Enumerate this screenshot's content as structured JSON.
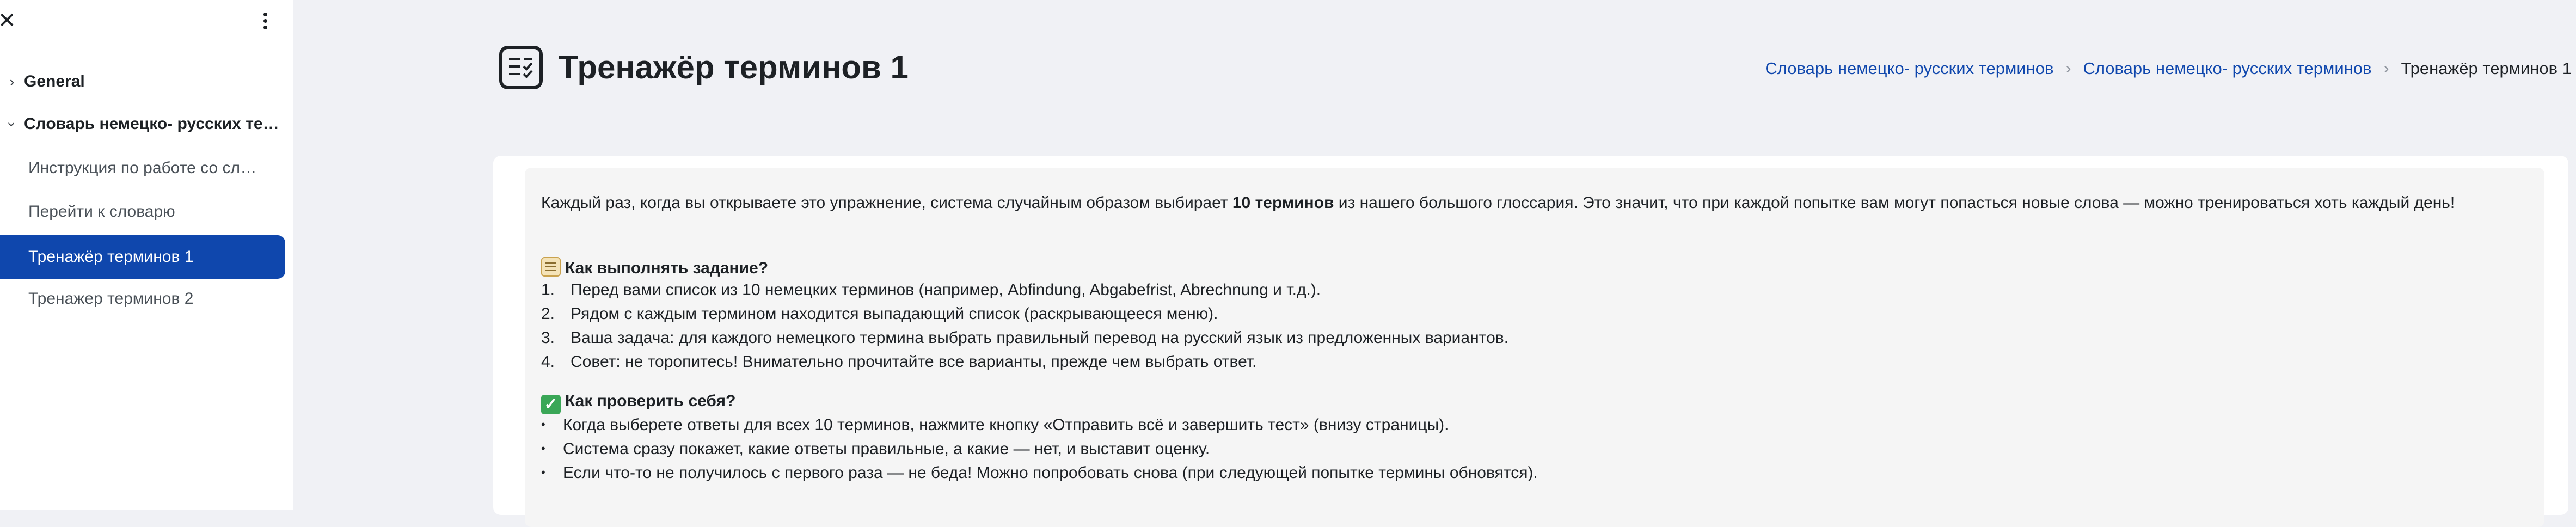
{
  "sidebar": {
    "close_icon": "✕",
    "sections": [
      {
        "label": "General"
      },
      {
        "label": "Словарь немецко- русских терминов"
      }
    ],
    "items": [
      {
        "label": "Инструкция по работе со словарем"
      },
      {
        "label": "Перейти к словарю"
      },
      {
        "label": "Тренажёр терминов 1"
      },
      {
        "label": "Тренажер терминов 2"
      }
    ]
  },
  "header": {
    "title": "Тренажёр терминов 1",
    "breadcrumb": [
      {
        "label": "Словарь немецко- русских терминов"
      },
      {
        "label": "Словарь немецко- русских терминов"
      },
      {
        "label": "Тренажёр терминов 1"
      }
    ]
  },
  "description": {
    "intro_before": "Каждый раз, когда вы открываете это упражнение, система случайным образом выбирает ",
    "intro_bold": "10 терминов",
    "intro_after": " из нашего большого глоссария. Это значит, что при каждой попытке вам могут попасться новые слова — можно тренироваться хоть каждый день!",
    "how_heading": "Как выполнять задание?",
    "how_items": [
      {
        "num": "1.",
        "text": "Перед вами список из 10 немецких терминов (например, Abfindung, Abgabefrist, Abrechnung и т.д.)."
      },
      {
        "num": "2.",
        "text": "Рядом с каждым термином находится выпадающий список (раскрывающееся меню)."
      },
      {
        "num": "3.",
        "text": "Ваша задача: для каждого немецкого термина выбрать правильный перевод на русский язык из предложенных вариантов."
      },
      {
        "num": "4.",
        "text": "Совет: не торопитесь! Внимательно прочитайте все варианты, прежде чем выбрать ответ."
      }
    ],
    "check_heading": "Как проверить себя?",
    "check_items": [
      {
        "bullet": "•",
        "text": "Когда выберете ответы для всех 10 терминов, нажмите кнопку «Отправить всё и завершить тест» (внизу страницы)."
      },
      {
        "bullet": "•",
        "text": "Система сразу покажет, какие ответы правильные, а какие — нет, и выставит оценку."
      },
      {
        "bullet": "•",
        "text": "Если что-то не получилось с первого раза — не беда! Можно попробовать снова (при следующей попытке термины обновятся)."
      }
    ]
  },
  "colors": {
    "accent": "#0f47ad",
    "page_bg": "#f0f1f5",
    "active_item_text": "#ffffff"
  },
  "icons": {
    "close": "close-icon",
    "more": "kebab-menu-icon",
    "section_expand": "chevron-icon",
    "activity": "quiz-checklist-icon",
    "breadcrumb_separator": "chevron-right-icon",
    "how_heading": "memo-emoji",
    "check_heading": "check-mark-emoji"
  }
}
